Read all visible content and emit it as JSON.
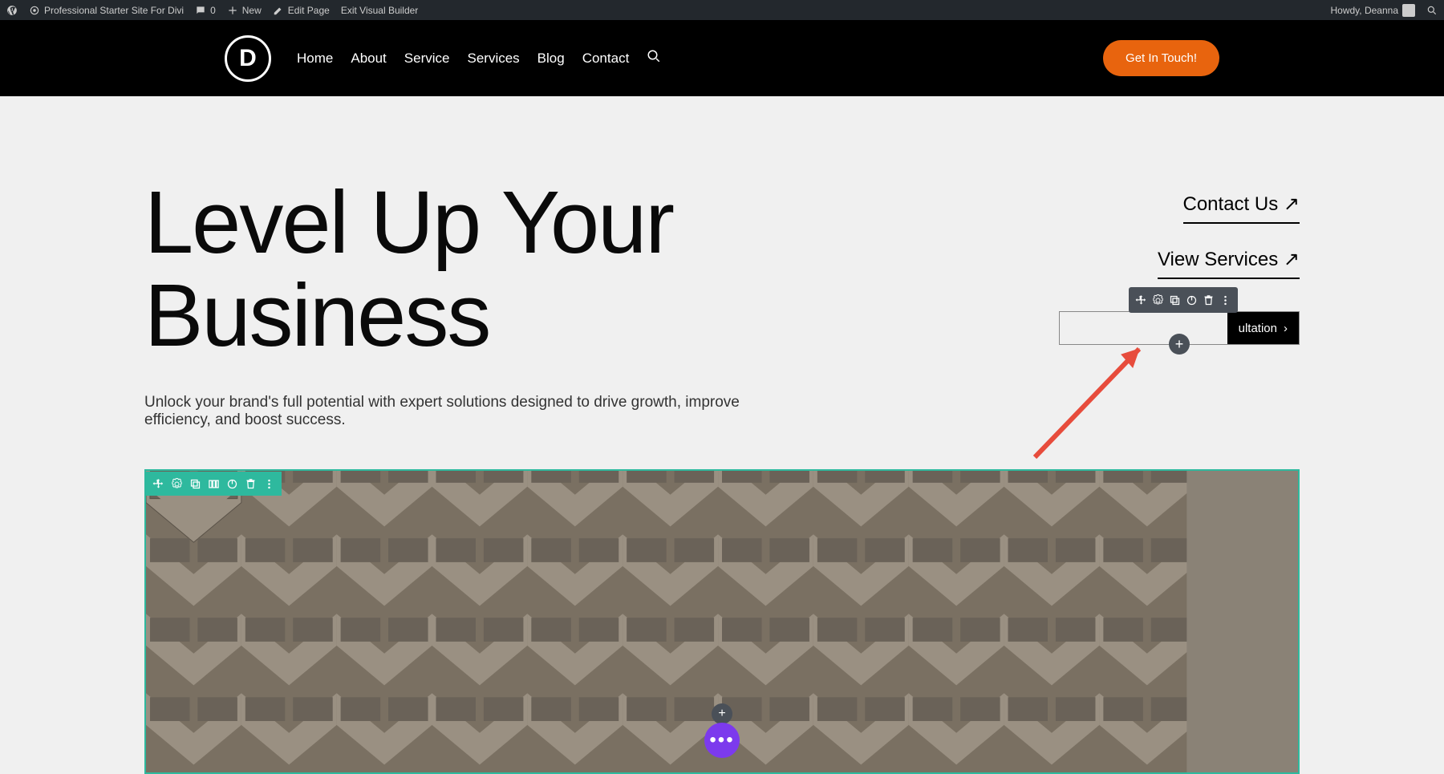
{
  "admin_bar": {
    "site_name": "Professional Starter Site For Divi",
    "comments_count": "0",
    "new_label": "New",
    "edit_page": "Edit Page",
    "exit_vb": "Exit Visual Builder",
    "howdy": "Howdy, Deanna"
  },
  "header": {
    "logo_letter": "D",
    "nav": {
      "home": "Home",
      "about": "About",
      "service": "Service",
      "services": "Services",
      "blog": "Blog",
      "contact": "Contact"
    },
    "cta": "Get In Touch!"
  },
  "hero": {
    "title": "Level Up Your Business",
    "subtitle": "Unlock your brand's full potential with expert solutions designed to drive growth, improve efficiency, and boost success.",
    "links": {
      "contact": "Contact Us ↗",
      "services": "View Services ↗"
    },
    "module_text_partial": "ultation",
    "module_chevron": "›"
  },
  "colors": {
    "section_blue": "#2ea3f2",
    "row_teal": "#2eb99e",
    "module_dark": "#4a5058",
    "cta_orange": "#e8640e",
    "purple_fab": "#7c3aed",
    "arrow_red": "#e74c3c"
  }
}
